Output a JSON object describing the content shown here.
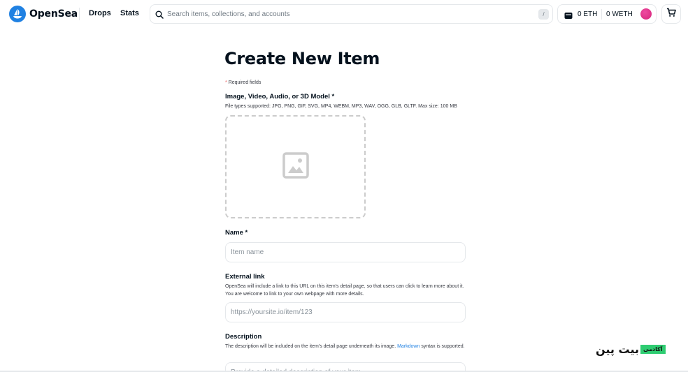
{
  "header": {
    "brand": "OpenSea",
    "nav": {
      "drops": "Drops",
      "stats": "Stats"
    },
    "search": {
      "placeholder": "Search items, collections, and accounts",
      "shortcut": "/"
    },
    "wallet": {
      "eth": "0 ETH",
      "weth": "0 WETH"
    },
    "icons": {
      "logo": "opensea-logo-icon",
      "search": "search-icon",
      "wallet": "wallet-icon",
      "cart": "cart-icon"
    },
    "accent_color": "#2081e2",
    "avatar_color": "#e03c8a"
  },
  "form": {
    "title": "Create New Item",
    "required_note": "Required fields",
    "media": {
      "label": "Image, Video, Audio, or 3D Model *",
      "help": "File types supported: JPG, PNG, GIF, SVG, MP4, WEBM, MP3, WAV, OGG, GLB, GLTF. Max size: 100 MB",
      "icon": "image-placeholder-icon"
    },
    "name": {
      "label": "Name *",
      "placeholder": "Item name"
    },
    "external_link": {
      "label": "External link",
      "help": "OpenSea will include a link to this URL on this item's detail page, so that users can click to learn more about it. You are welcome to link to your own webpage with more details.",
      "placeholder": "https://yoursite.io/item/123"
    },
    "description": {
      "label": "Description",
      "help_before": "The description will be included on the item's detail page underneath its image. ",
      "help_link": "Markdown",
      "help_after": " syntax is supported.",
      "placeholder": "Provide a detailed description of your item."
    }
  },
  "watermark": {
    "text": "بیت پین",
    "badge": "آکادمی"
  }
}
